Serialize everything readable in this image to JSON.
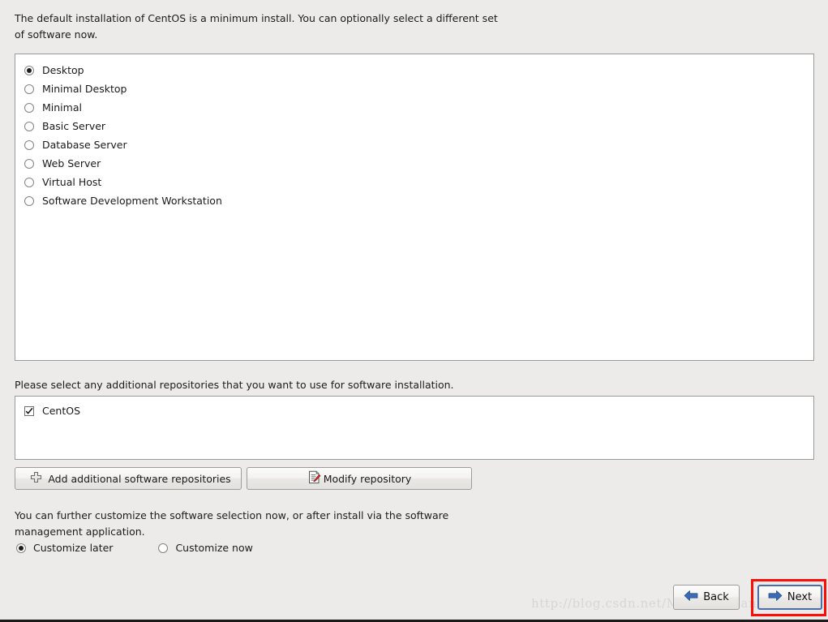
{
  "intro": {
    "text": "The default installation of CentOS is a minimum install. You can optionally select a different set of software now."
  },
  "software_selection": {
    "selected": "Desktop",
    "options": [
      {
        "label": "Desktop",
        "checked": true
      },
      {
        "label": "Minimal Desktop",
        "checked": false
      },
      {
        "label": "Minimal",
        "checked": false
      },
      {
        "label": "Basic Server",
        "checked": false
      },
      {
        "label": "Database Server",
        "checked": false
      },
      {
        "label": "Web Server",
        "checked": false
      },
      {
        "label": "Virtual Host",
        "checked": false
      },
      {
        "label": "Software Development Workstation",
        "checked": false
      }
    ]
  },
  "repositories": {
    "label": "Please select any additional repositories that you want to use for software installation.",
    "items": [
      {
        "label": "CentOS",
        "checked": true
      }
    ],
    "add_button": {
      "label": "Add additional software repositories",
      "icon": "plus-icon"
    },
    "modify_button": {
      "label": "Modify repository",
      "icon": "document-edit-icon"
    }
  },
  "customize": {
    "label": "You can further customize the software selection now, or after install via the software management application.",
    "selected": "Customize later",
    "options": [
      {
        "label": "Customize later",
        "checked": true
      },
      {
        "label": "Customize now",
        "checked": false
      }
    ]
  },
  "navigation": {
    "back": {
      "label": "Back",
      "icon": "arrow-left-icon"
    },
    "next": {
      "label": "Next",
      "icon": "arrow-right-icon",
      "focused": true,
      "highlighted": true
    }
  },
  "watermark": {
    "text": "http://blog.csdn.net/MusicBoyDaniel"
  },
  "colors": {
    "background": "#ecebe9",
    "listbox_background": "#ffffff",
    "border": "#9a9a9a",
    "accent_arrow": "#3b6bb5",
    "highlight_box": "#fb0d08",
    "focus_border": "#4a6ea8",
    "text": "#1a1a1a"
  }
}
